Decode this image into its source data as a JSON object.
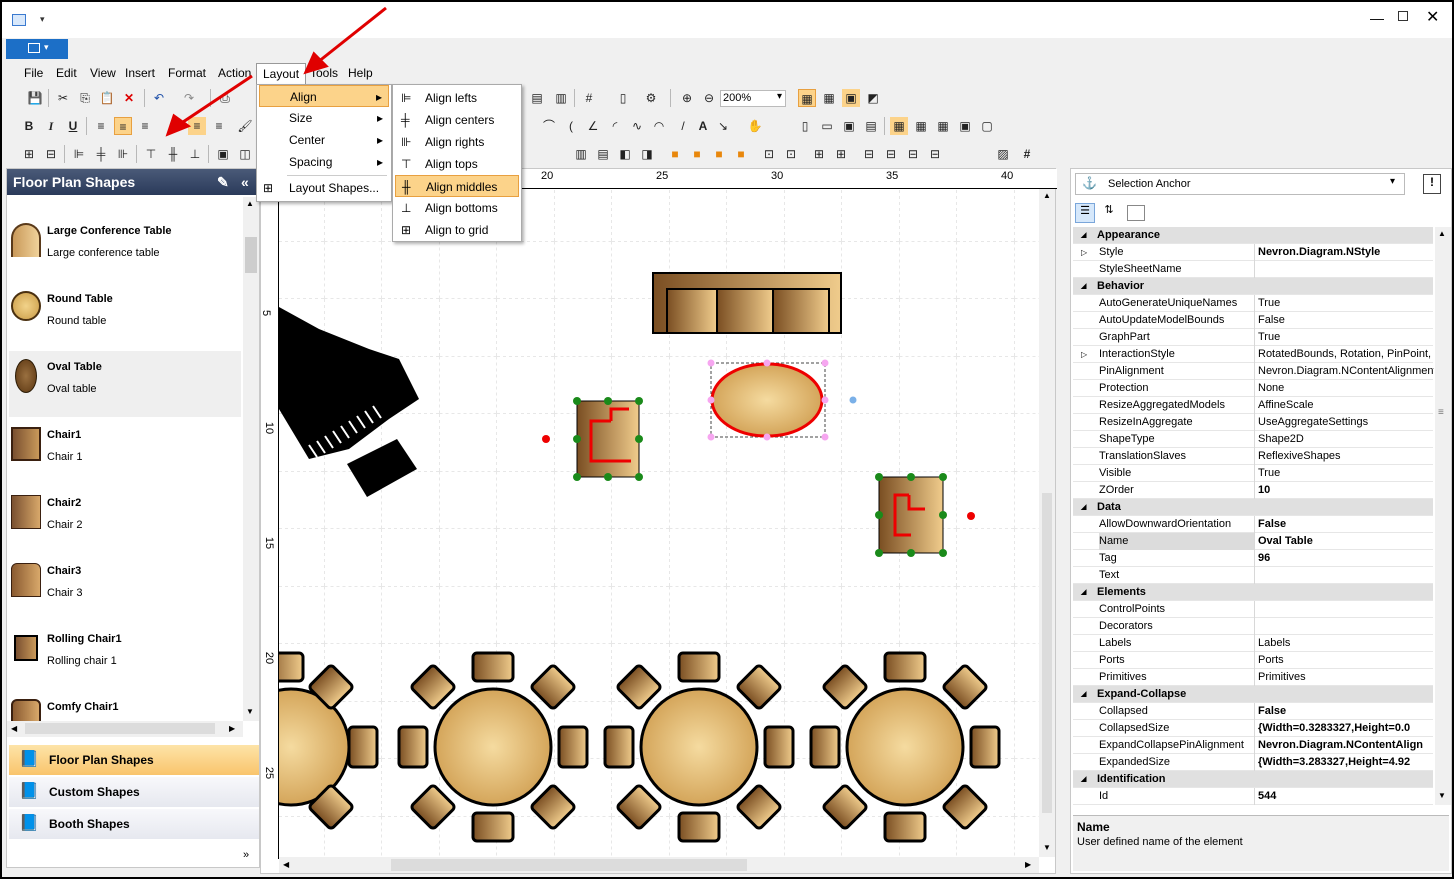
{
  "menubar": {
    "items": [
      "File",
      "Edit",
      "View",
      "Insert",
      "Format",
      "Action",
      "Layout",
      "Tools",
      "Help"
    ]
  },
  "layout_menu": {
    "items": [
      {
        "label": "Align",
        "has_sub": true
      },
      {
        "label": "Size",
        "has_sub": true
      },
      {
        "label": "Center",
        "has_sub": true
      },
      {
        "label": "Spacing",
        "has_sub": true
      },
      {
        "label": "Layout Shapes...",
        "has_sub": false
      }
    ]
  },
  "align_menu": {
    "items": [
      "Align lefts",
      "Align centers",
      "Align rights",
      "Align tops",
      "Align middles",
      "Align bottoms",
      "Align to grid"
    ]
  },
  "toolbar": {
    "zoom": "200%"
  },
  "left_panel": {
    "title": "Floor Plan Shapes",
    "shapes": [
      {
        "name": "Large Conference Table",
        "desc": "Large conference table"
      },
      {
        "name": "Round Table",
        "desc": "Round table"
      },
      {
        "name": "Oval Table",
        "desc": "Oval table"
      },
      {
        "name": "Chair1",
        "desc": "Chair 1"
      },
      {
        "name": "Chair2",
        "desc": "Chair 2"
      },
      {
        "name": "Chair3",
        "desc": "Chair 3"
      },
      {
        "name": "Rolling Chair1",
        "desc": "Rolling chair 1"
      },
      {
        "name": "Comfy Chair1",
        "desc": ""
      }
    ],
    "categories": [
      "Floor Plan Shapes",
      "Custom Shapes",
      "Booth Shapes"
    ]
  },
  "ruler": {
    "h": [
      "20",
      "25",
      "30",
      "35",
      "40"
    ],
    "v": [
      "5",
      "10",
      "15",
      "20",
      "25"
    ]
  },
  "propgrid": {
    "selector": "Selection Anchor",
    "rows": [
      {
        "cat": true,
        "name": "Appearance"
      },
      {
        "name": "Style",
        "value": "Nevron.Diagram.NStyle",
        "bold": true,
        "exp": true
      },
      {
        "name": "StyleSheetName",
        "value": ""
      },
      {
        "cat": true,
        "name": "Behavior"
      },
      {
        "name": "AutoGenerateUniqueNames",
        "value": "True"
      },
      {
        "name": "AutoUpdateModelBounds",
        "value": "False"
      },
      {
        "name": "GraphPart",
        "value": "True"
      },
      {
        "name": "InteractionStyle",
        "value": "RotatedBounds, Rotation, PinPoint, S",
        "exp": true
      },
      {
        "name": "PinAlignment",
        "value": "Nevron.Diagram.NContentAlignment"
      },
      {
        "name": "Protection",
        "value": "None"
      },
      {
        "name": "ResizeAggregatedModels",
        "value": "AffineScale"
      },
      {
        "name": "ResizeInAggregate",
        "value": "UseAggregateSettings"
      },
      {
        "name": "ShapeType",
        "value": "Shape2D"
      },
      {
        "name": "TranslationSlaves",
        "value": "ReflexiveShapes"
      },
      {
        "name": "Visible",
        "value": "True"
      },
      {
        "name": "ZOrder",
        "value": "10",
        "bold": true
      },
      {
        "cat": true,
        "name": "Data"
      },
      {
        "name": "AllowDownwardOrientation",
        "value": "False",
        "bold": true
      },
      {
        "name": "Name",
        "value": "Oval Table",
        "bold": true,
        "sel": true
      },
      {
        "name": "Tag",
        "value": "96",
        "bold": true
      },
      {
        "name": "Text",
        "value": ""
      },
      {
        "cat": true,
        "name": "Elements"
      },
      {
        "name": "ControlPoints",
        "value": ""
      },
      {
        "name": "Decorators",
        "value": ""
      },
      {
        "name": "Labels",
        "value": "Labels"
      },
      {
        "name": "Ports",
        "value": "Ports"
      },
      {
        "name": "Primitives",
        "value": "Primitives"
      },
      {
        "cat": true,
        "name": "Expand-Collapse"
      },
      {
        "name": "Collapsed",
        "value": "False",
        "bold": true
      },
      {
        "name": "CollapsedSize",
        "value": "{Width=0.3283327,Height=0.0",
        "bold": true
      },
      {
        "name": "ExpandCollapsePinAlignment",
        "value": "Nevron.Diagram.NContentAlign",
        "bold": true
      },
      {
        "name": "ExpandedSize",
        "value": "{Width=3.283327,Height=4.92",
        "bold": true
      },
      {
        "cat": true,
        "name": "Identification"
      },
      {
        "name": "Id",
        "value": "544",
        "bold": true
      }
    ],
    "help_title": "Name",
    "help_text": "User defined name of the element"
  },
  "colors": {
    "arrow": "#e00000",
    "highlight": "#fcd38a",
    "titleblue": "#1c6fc7"
  }
}
